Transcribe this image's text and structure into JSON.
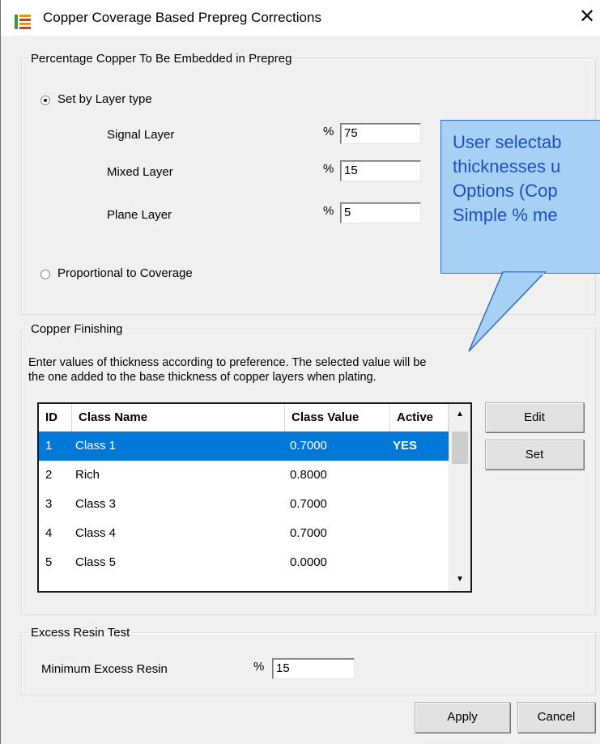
{
  "window": {
    "title": "Copper Coverage Based Prepreg Corrections",
    "close_glyph": "✕"
  },
  "prepreg_group": {
    "legend": "Percentage Copper To Be Embedded in Prepreg",
    "radio_layer_type": {
      "label": "Set by Layer type",
      "checked": true
    },
    "layers": [
      {
        "label": "Signal Layer",
        "percent_sign": "%",
        "value": "75"
      },
      {
        "label": "Mixed Layer",
        "percent_sign": "%",
        "value": "15"
      },
      {
        "label": "Plane Layer",
        "percent_sign": "%",
        "value": "5"
      }
    ],
    "radio_proportional": {
      "label": "Proportional to Coverage",
      "checked": false
    }
  },
  "finishing_group": {
    "legend": "Copper Finishing",
    "description_line1": "Enter values of thickness according to preference. The selected value will be",
    "description_line2": "the one added to the base thickness of copper layers when plating.",
    "table": {
      "columns": [
        "ID",
        "Class Name",
        "Class Value",
        "Active"
      ],
      "rows": [
        {
          "id": "1",
          "name": "Class 1",
          "value": "0.7000",
          "active": "YES",
          "selected": true
        },
        {
          "id": "2",
          "name": "Rich",
          "value": "0.8000",
          "active": ""
        },
        {
          "id": "3",
          "name": "Class 3",
          "value": "0.7000",
          "active": ""
        },
        {
          "id": "4",
          "name": "Class 4",
          "value": "0.7000",
          "active": ""
        },
        {
          "id": "5",
          "name": "Class 5",
          "value": "0.0000",
          "active": ""
        }
      ]
    },
    "edit_button": "Edit",
    "set_button": "Set"
  },
  "resin_group": {
    "legend": "Excess Resin Test",
    "label": "Minimum Excess Resin",
    "percent_sign": "%",
    "value": "15"
  },
  "buttons": {
    "apply": "Apply",
    "cancel": "Cancel"
  },
  "callout": {
    "lines": [
      "User selectab",
      "thicknesses u",
      "Options (Cop",
      "Simple % me"
    ],
    "fill_color": "#a7d0f5",
    "text_color": "#1f4fbf"
  },
  "colors": {
    "selection": "#0078d7",
    "dialog_bg": "#f0f0f0"
  }
}
